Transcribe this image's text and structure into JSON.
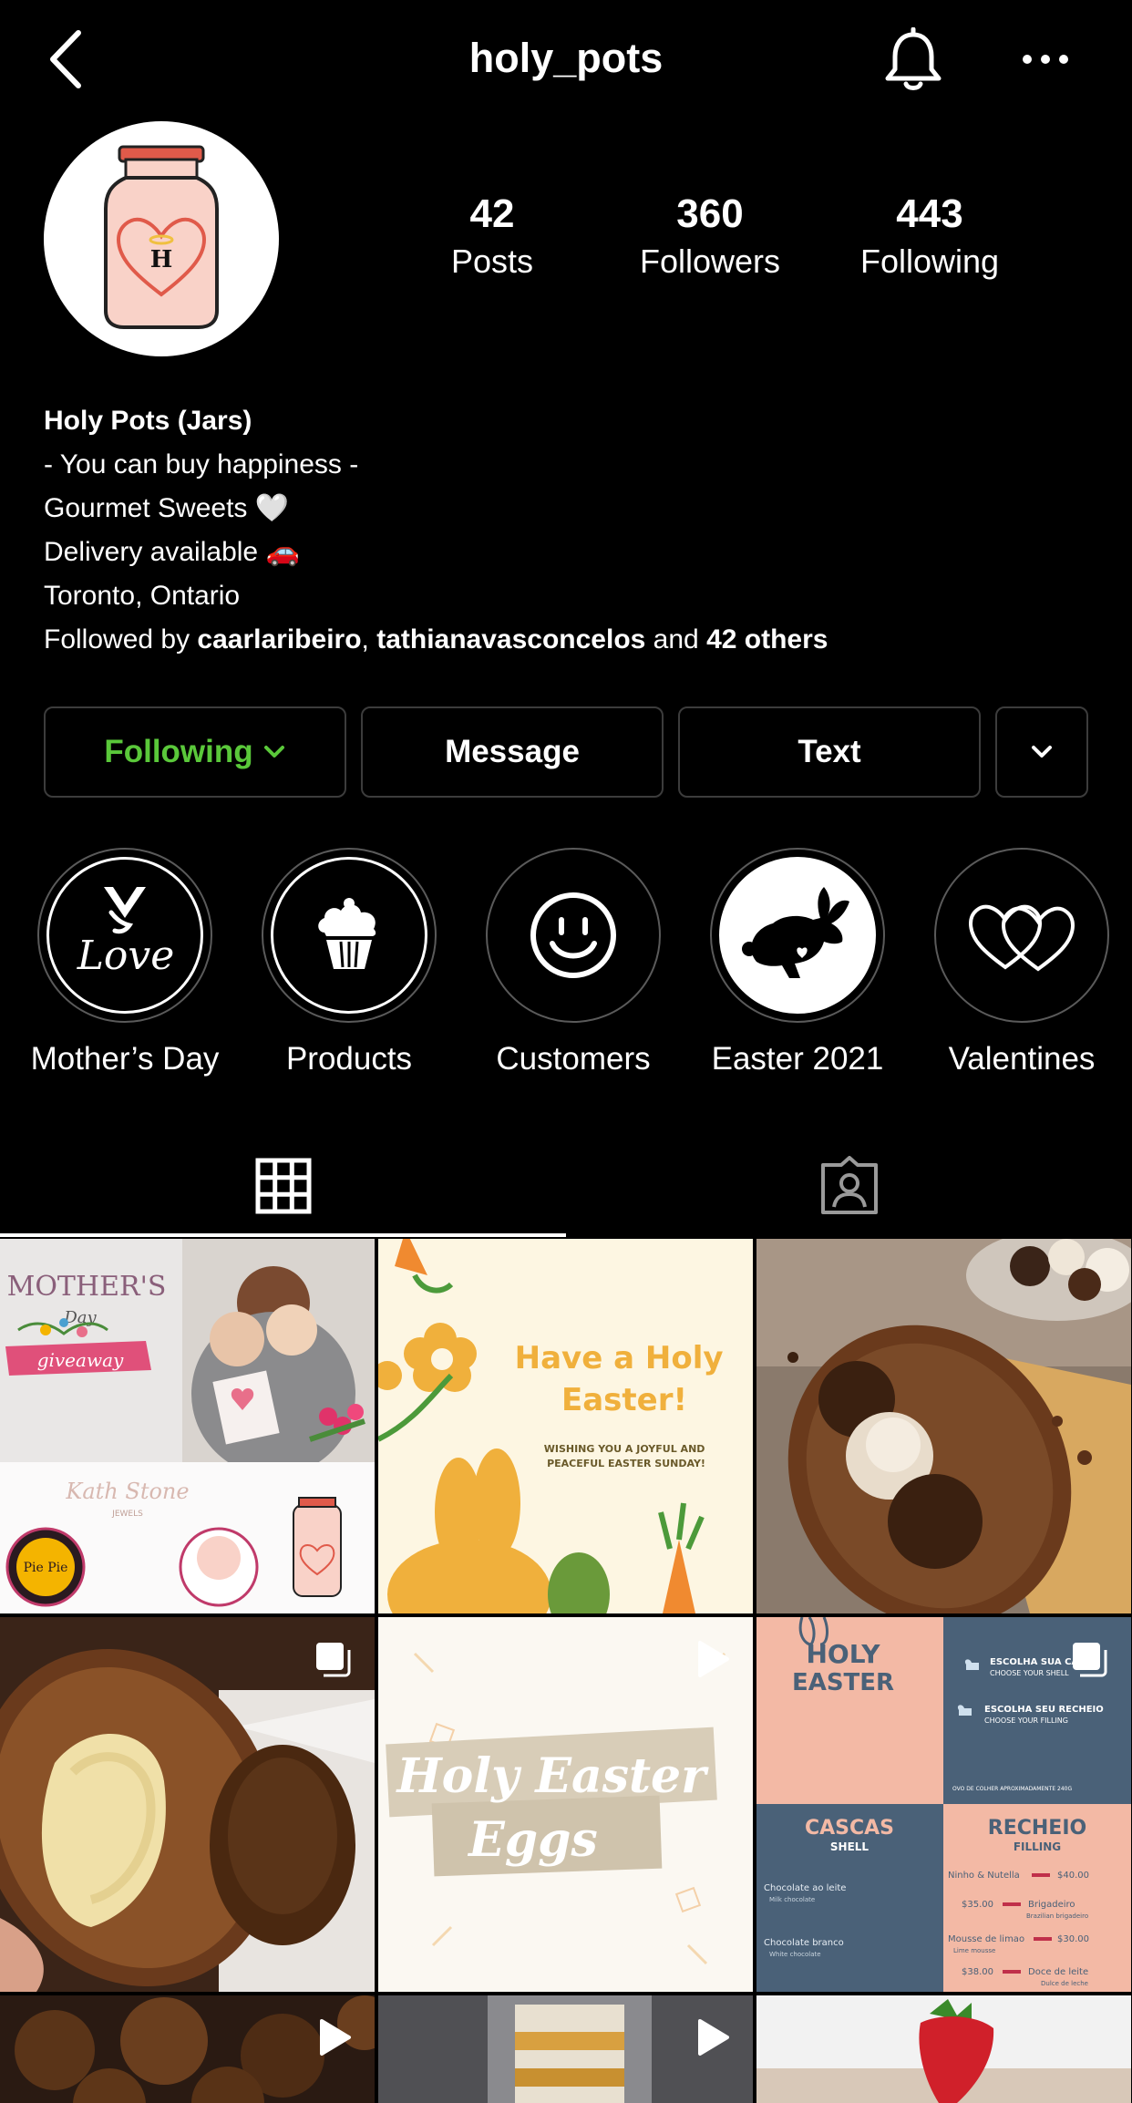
{
  "header": {
    "title": "holy_pots"
  },
  "profile": {
    "stats": [
      {
        "value": "42",
        "label": "Posts"
      },
      {
        "value": "360",
        "label": "Followers"
      },
      {
        "value": "443",
        "label": "Following"
      }
    ],
    "name": "Holy Pots (Jars)",
    "bio_lines": [
      "- You can buy happiness -",
      "Gourmet Sweets 🤍",
      "Delivery available 🚗",
      "Toronto, Ontario"
    ],
    "followed_by": {
      "prefix": "Followed by ",
      "user1": "caarlaribeiro",
      "sep": ", ",
      "user2": "tathianavasconcelos",
      "and": " and ",
      "others": "42 others"
    }
  },
  "actions": {
    "following": "Following",
    "message": "Message",
    "text": "Text"
  },
  "highlights": [
    {
      "label": "Mother’s Day",
      "icon": "mothers-day-love-icon"
    },
    {
      "label": "Products",
      "icon": "cupcake-icon"
    },
    {
      "label": "Customers",
      "icon": "smiley-icon"
    },
    {
      "label": "Easter 2021",
      "icon": "bunny-icon"
    },
    {
      "label": "Valentines",
      "icon": "hearts-icon"
    }
  ],
  "tabs": [
    {
      "name": "grid",
      "icon": "grid-icon",
      "active": true
    },
    {
      "name": "tagged",
      "icon": "tagged-person-icon",
      "active": false
    }
  ],
  "posts": {
    "p1": {
      "title": "MOTHER'S",
      "sub": "Day",
      "banner": "giveaway",
      "brand": "Kath Stone",
      "brand_sub": "JEWELS",
      "logo": "Pie Pie"
    },
    "p2": {
      "title": "Have a  Holy Easter!",
      "sub": "WISHING YOU A JOYFUL AND PEACEFUL EASTER SUNDAY!"
    },
    "p5": {
      "line1": "Holy Easter",
      "line2": "Eggs"
    },
    "p6": {
      "title1": "HOLY",
      "title2": "EASTER",
      "step1": "ESCOLHA SUA CASCA",
      "step1_en": "CHOOSE YOUR SHELL",
      "step2": "ESCOLHA SEU RECHEIO",
      "step2_en": "CHOOSE YOUR FILLING",
      "note": "OVO DE COLHER APROXIMADAMENTE 240G",
      "cascas": "CASCAS",
      "shell": "SHELL",
      "recheio": "RECHEIO",
      "filling": "FILLING",
      "c1": "Chocolate ao leite",
      "c1_en": "Milk chocolate",
      "c2": "Chocolate branco",
      "c2_en": "White chocolate",
      "r1": "Ninho & Nutella",
      "r1_price": "$40.00",
      "r2": "Brigadeiro",
      "r2_price": "$35.00",
      "r2_en": "Brazilian brigadeiro",
      "r3": "Mousse de limao",
      "r3_price": "$30.00",
      "r3_en": "Lime mousse",
      "r4": "Doce de leite",
      "r4_price": "$38.00",
      "r4_en": "Dulce de leche"
    }
  },
  "colors": {
    "following_green": "#5ac83a",
    "border": "#3c3c3c",
    "easter_cream": "#fdf6e2",
    "easter_orange": "#f0b03c",
    "menu_pink": "#f3b9a5",
    "menu_blue": "#4a6178"
  }
}
